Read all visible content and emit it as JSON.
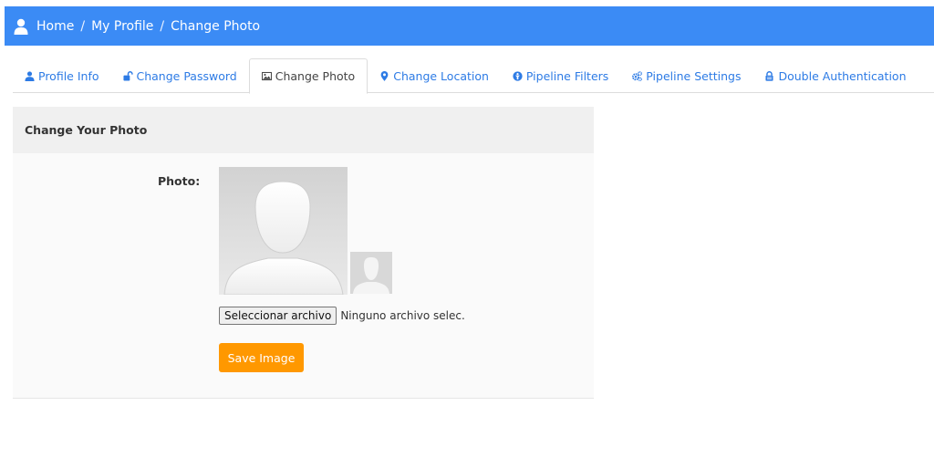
{
  "breadcrumb": {
    "home": "Home",
    "sep1": "/",
    "profile": "My Profile",
    "sep2": "/",
    "current": "Change Photo"
  },
  "tabs": [
    {
      "label": "Profile Info",
      "icon": "user-icon"
    },
    {
      "label": "Change Password",
      "icon": "unlock-icon"
    },
    {
      "label": "Change Photo",
      "icon": "image-icon"
    },
    {
      "label": "Change Location",
      "icon": "map-marker-icon"
    },
    {
      "label": "Pipeline Filters",
      "icon": "filter-circle-icon"
    },
    {
      "label": "Pipeline Settings",
      "icon": "gears-icon"
    },
    {
      "label": "Double Authentication",
      "icon": "lock-icon"
    }
  ],
  "active_tab": "Change Photo",
  "panel": {
    "title": "Change Your Photo",
    "photo_label": "Photo:",
    "file_button": "Seleccionar archivo",
    "file_status": "Ninguno archivo selec.",
    "save_button": "Save Image"
  },
  "colors": {
    "topbar": "#3b8bf5",
    "link": "#2d7be5",
    "save_button": "#ff9800"
  }
}
